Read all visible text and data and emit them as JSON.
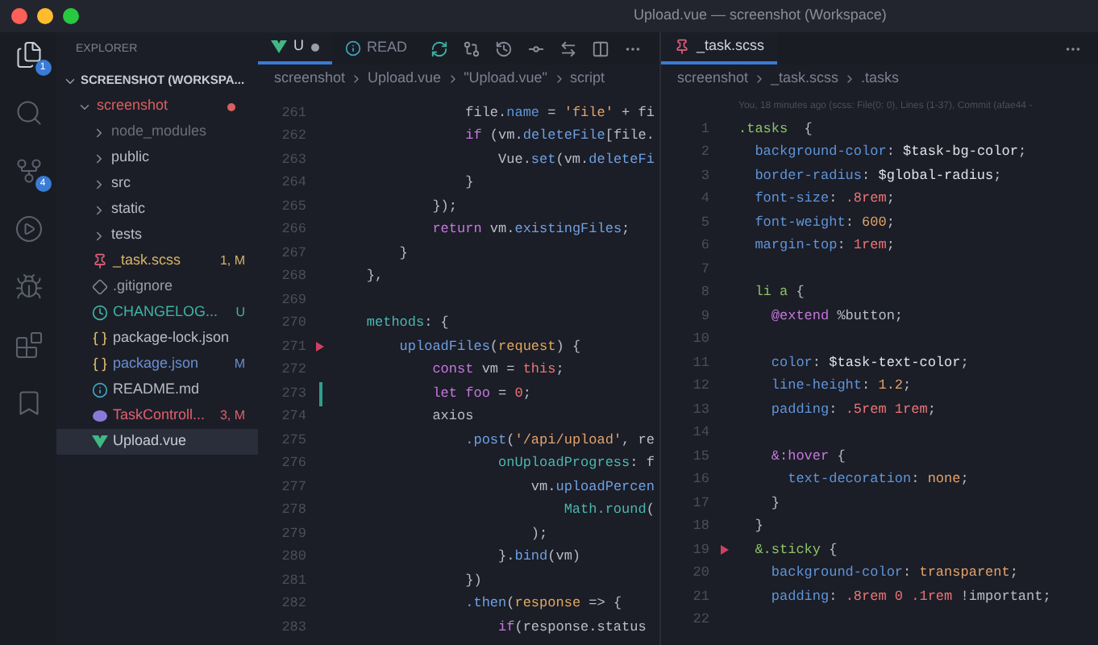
{
  "window": {
    "title": "Upload.vue — screenshot (Workspace)"
  },
  "activity_bar": [
    {
      "kind": "files",
      "badge": "1",
      "selected": true
    },
    {
      "kind": "search",
      "selected": false
    },
    {
      "kind": "source_control",
      "badge": "4",
      "selected": false
    },
    {
      "kind": "run",
      "selected": false
    },
    {
      "kind": "debug",
      "selected": false
    },
    {
      "kind": "extensions",
      "selected": false
    },
    {
      "kind": "bookmarks",
      "selected": false
    }
  ],
  "sidebar": {
    "title": "EXPLORER",
    "workspace": {
      "label": "SCREENSHOT (WORKSPA...",
      "expanded": true,
      "children": [
        {
          "kind": "folder",
          "label": "screenshot",
          "color": "#d9605f",
          "expanded": true,
          "problem_dot": true,
          "children": [
            {
              "kind": "folder",
              "label": "node_modules",
              "color": "#6b6f7a",
              "expanded": false
            },
            {
              "kind": "folder",
              "label": "public",
              "color": "#b8bcc6",
              "expanded": false
            },
            {
              "kind": "folder",
              "label": "src",
              "color": "#b8bcc6",
              "expanded": false
            },
            {
              "kind": "folder",
              "label": "static",
              "color": "#b8bcc6",
              "expanded": false
            },
            {
              "kind": "folder",
              "label": "tests",
              "color": "#b8bcc6",
              "expanded": false
            },
            {
              "kind": "scss",
              "label": "_task.scss",
              "color": "#d7b46a",
              "status": "1, M",
              "selected": false
            },
            {
              "kind": "git",
              "label": ".gitignore",
              "color": "#9a9eaa",
              "selected": false
            },
            {
              "kind": "changelog",
              "label": "CHANGELOG...",
              "color": "#3fb4a6",
              "status": "U",
              "selected": false
            },
            {
              "kind": "json",
              "label": "package-lock.json",
              "color": "#b8bcc6",
              "selected": false
            },
            {
              "kind": "json",
              "label": "package.json",
              "color": "#6a8fd0",
              "status": "M",
              "selected": false
            },
            {
              "kind": "info",
              "label": "README.md",
              "color": "#b8bcc6",
              "selected": false
            },
            {
              "kind": "php",
              "label": "TaskControll...",
              "color": "#e06070",
              "status": "3, M",
              "selected": false
            },
            {
              "kind": "vue",
              "label": "Upload.vue",
              "color": "#c8ccd4",
              "selected": true
            }
          ]
        }
      ]
    }
  },
  "left_editor": {
    "tabs": [
      {
        "kind": "vue",
        "label": "U",
        "dirty": true,
        "selected": true
      },
      {
        "kind": "info",
        "label": "READ",
        "dirty": false,
        "selected": false
      }
    ],
    "breadcrumb": [
      "screenshot",
      "Upload.vue",
      "\"Upload.vue\"",
      "script"
    ],
    "lines": [
      {
        "number": "261",
        "tokens": [
          {
            "text": "                file.",
            "kind": "plain"
          },
          {
            "text": "name",
            "kind": "prop"
          },
          {
            "text": " = ",
            "kind": "plain"
          },
          {
            "text": "'file'",
            "kind": "string"
          },
          {
            "text": " + fi",
            "kind": "plain"
          }
        ]
      },
      {
        "number": "262",
        "tokens": [
          {
            "text": "                if",
            "kind": "keyword"
          },
          {
            "text": " (vm.",
            "kind": "plain"
          },
          {
            "text": "deleteFile",
            "kind": "func"
          },
          {
            "text": "[file.",
            "kind": "plain"
          }
        ]
      },
      {
        "number": "263",
        "tokens": [
          {
            "text": "                    Vue.",
            "kind": "plain"
          },
          {
            "text": "set",
            "kind": "func"
          },
          {
            "text": "(vm.",
            "kind": "plain"
          },
          {
            "text": "deleteFi",
            "kind": "func"
          }
        ]
      },
      {
        "number": "264",
        "tokens": [
          {
            "text": "                }",
            "kind": "plain"
          }
        ]
      },
      {
        "number": "265",
        "tokens": [
          {
            "text": "            });",
            "kind": "plain"
          }
        ]
      },
      {
        "number": "266",
        "tokens": [
          {
            "text": "            return",
            "kind": "keyword"
          },
          {
            "text": " vm.",
            "kind": "plain"
          },
          {
            "text": "existingFiles",
            "kind": "func"
          },
          {
            "text": ";",
            "kind": "plain"
          }
        ]
      },
      {
        "number": "267",
        "tokens": [
          {
            "text": "        }",
            "kind": "plain"
          }
        ]
      },
      {
        "number": "268",
        "tokens": [
          {
            "text": "    },",
            "kind": "plain"
          }
        ]
      },
      {
        "number": "269"
      },
      {
        "number": "270",
        "tokens": [
          {
            "text": "    methods",
            "kind": "teal"
          },
          {
            "text": ": {",
            "kind": "plain"
          }
        ]
      },
      {
        "number": "271",
        "fold_marker": true,
        "tokens": [
          {
            "text": "        uploadFiles",
            "kind": "func"
          },
          {
            "text": "(",
            "kind": "plain"
          },
          {
            "text": "request",
            "kind": "param"
          },
          {
            "text": ") {",
            "kind": "plain"
          }
        ]
      },
      {
        "number": "272",
        "tokens": [
          {
            "text": "            const",
            "kind": "keyword"
          },
          {
            "text": " vm = ",
            "kind": "plain"
          },
          {
            "text": "this",
            "kind": "number"
          },
          {
            "text": ";",
            "kind": "plain"
          }
        ]
      },
      {
        "number": "273",
        "change_bar": true,
        "tokens": [
          {
            "text": "            let",
            "kind": "keyword"
          },
          {
            "text": " foo",
            "kind": "keyword"
          },
          {
            "text": " = ",
            "kind": "plain"
          },
          {
            "text": "0",
            "kind": "number"
          },
          {
            "text": ";",
            "kind": "plain"
          }
        ]
      },
      {
        "number": "274",
        "tokens": [
          {
            "text": "            axios",
            "kind": "plain"
          }
        ]
      },
      {
        "number": "275",
        "tokens": [
          {
            "text": "                .post",
            "kind": "func"
          },
          {
            "text": "(",
            "kind": "plain"
          },
          {
            "text": "'/api/upload'",
            "kind": "string"
          },
          {
            "text": ", re",
            "kind": "plain"
          }
        ]
      },
      {
        "number": "276",
        "tokens": [
          {
            "text": "                    onUploadProgress",
            "kind": "teal"
          },
          {
            "text": ": f",
            "kind": "plain"
          }
        ]
      },
      {
        "number": "277",
        "tokens": [
          {
            "text": "                        vm.",
            "kind": "plain"
          },
          {
            "text": "uploadPercen",
            "kind": "func"
          }
        ]
      },
      {
        "number": "278",
        "tokens": [
          {
            "text": "                            Math.round",
            "kind": "teal"
          },
          {
            "text": "(",
            "kind": "plain"
          }
        ]
      },
      {
        "number": "279",
        "tokens": [
          {
            "text": "                        );",
            "kind": "plain"
          }
        ]
      },
      {
        "number": "280",
        "tokens": [
          {
            "text": "                    }.",
            "kind": "plain"
          },
          {
            "text": "bind",
            "kind": "func"
          },
          {
            "text": "(vm)",
            "kind": "plain"
          }
        ]
      },
      {
        "number": "281",
        "tokens": [
          {
            "text": "                })",
            "kind": "plain"
          }
        ]
      },
      {
        "number": "282",
        "tokens": [
          {
            "text": "                .then",
            "kind": "func"
          },
          {
            "text": "(",
            "kind": "plain"
          },
          {
            "text": "response",
            "kind": "param"
          },
          {
            "text": " => {",
            "kind": "plain"
          }
        ]
      },
      {
        "number": "283",
        "tokens": [
          {
            "text": "                    if",
            "kind": "keyword"
          },
          {
            "text": "(response.status",
            "kind": "plain"
          }
        ]
      }
    ]
  },
  "right_editor": {
    "tabs": [
      {
        "kind": "scss",
        "label": "_task.scss",
        "dirty": false,
        "selected": true
      }
    ],
    "breadcrumb": [
      "screenshot",
      "_task.scss",
      ".tasks"
    ],
    "blame": "You, 18 minutes ago (scss: File(0: 0), Lines (1-37), Commit (afae44 -",
    "lines": [
      {
        "number": "1",
        "tokens": [
          {
            "text": ".tasks",
            "kind": "selector"
          },
          {
            "text": "  {",
            "kind": "plain"
          }
        ]
      },
      {
        "number": "2",
        "tokens": [
          {
            "text": "  background-color",
            "kind": "prop"
          },
          {
            "text": ": ",
            "kind": "plain"
          },
          {
            "text": "$task-bg-color",
            "kind": "var"
          },
          {
            "text": ";",
            "kind": "plain"
          }
        ]
      },
      {
        "number": "3",
        "tokens": [
          {
            "text": "  border-radius",
            "kind": "prop"
          },
          {
            "text": ": ",
            "kind": "plain"
          },
          {
            "text": "$global-radius",
            "kind": "var"
          },
          {
            "text": ";",
            "kind": "plain"
          }
        ]
      },
      {
        "number": "4",
        "tokens": [
          {
            "text": "  font-size",
            "kind": "prop"
          },
          {
            "text": ": ",
            "kind": "plain"
          },
          {
            "text": ".8rem",
            "kind": "number"
          },
          {
            "text": ";",
            "kind": "plain"
          }
        ]
      },
      {
        "number": "5",
        "tokens": [
          {
            "text": "  font-weight",
            "kind": "prop"
          },
          {
            "text": ": ",
            "kind": "plain"
          },
          {
            "text": "600",
            "kind": "string"
          },
          {
            "text": ";",
            "kind": "plain"
          }
        ]
      },
      {
        "number": "6",
        "tokens": [
          {
            "text": "  margin-top",
            "kind": "prop"
          },
          {
            "text": ": ",
            "kind": "plain"
          },
          {
            "text": "1rem",
            "kind": "number"
          },
          {
            "text": ";",
            "kind": "plain"
          }
        ]
      },
      {
        "number": "7"
      },
      {
        "number": "8",
        "tokens": [
          {
            "text": "  li a",
            "kind": "selector"
          },
          {
            "text": " {",
            "kind": "plain"
          }
        ]
      },
      {
        "number": "9",
        "tokens": [
          {
            "text": "    @extend",
            "kind": "keyword"
          },
          {
            "text": " %button;",
            "kind": "plain"
          }
        ]
      },
      {
        "number": "10"
      },
      {
        "number": "11",
        "tokens": [
          {
            "text": "    color",
            "kind": "prop"
          },
          {
            "text": ": ",
            "kind": "plain"
          },
          {
            "text": "$task-text-color",
            "kind": "var"
          },
          {
            "text": ";",
            "kind": "plain"
          }
        ]
      },
      {
        "number": "12",
        "tokens": [
          {
            "text": "    line-height",
            "kind": "prop"
          },
          {
            "text": ": ",
            "kind": "plain"
          },
          {
            "text": "1.2",
            "kind": "string"
          },
          {
            "text": ";",
            "kind": "plain"
          }
        ]
      },
      {
        "number": "13",
        "tokens": [
          {
            "text": "    padding",
            "kind": "prop"
          },
          {
            "text": ": ",
            "kind": "plain"
          },
          {
            "text": ".5rem 1rem",
            "kind": "number"
          },
          {
            "text": ";",
            "kind": "plain"
          }
        ]
      },
      {
        "number": "14"
      },
      {
        "number": "15",
        "tokens": [
          {
            "text": "    &:hover",
            "kind": "keyword"
          },
          {
            "text": " {",
            "kind": "plain"
          }
        ]
      },
      {
        "number": "16",
        "tokens": [
          {
            "text": "      text-decoration",
            "kind": "prop"
          },
          {
            "text": ": ",
            "kind": "plain"
          },
          {
            "text": "none",
            "kind": "string"
          },
          {
            "text": ";",
            "kind": "plain"
          }
        ]
      },
      {
        "number": "17",
        "tokens": [
          {
            "text": "    }",
            "kind": "plain"
          }
        ]
      },
      {
        "number": "18",
        "tokens": [
          {
            "text": "  }",
            "kind": "plain"
          }
        ]
      },
      {
        "number": "19",
        "fold_marker": true,
        "tokens": [
          {
            "text": "  &.sticky",
            "kind": "selector"
          },
          {
            "text": " {",
            "kind": "plain"
          }
        ]
      },
      {
        "number": "20",
        "tokens": [
          {
            "text": "    background-color",
            "kind": "prop"
          },
          {
            "text": ": ",
            "kind": "plain"
          },
          {
            "text": "transparent",
            "kind": "string"
          },
          {
            "text": ";",
            "kind": "plain"
          }
        ]
      },
      {
        "number": "21",
        "tokens": [
          {
            "text": "    padding",
            "kind": "prop"
          },
          {
            "text": ": ",
            "kind": "plain"
          },
          {
            "text": ".8rem 0 .1rem",
            "kind": "number"
          },
          {
            "text": " !important;",
            "kind": "plain"
          }
        ]
      },
      {
        "number": "22"
      }
    ]
  }
}
